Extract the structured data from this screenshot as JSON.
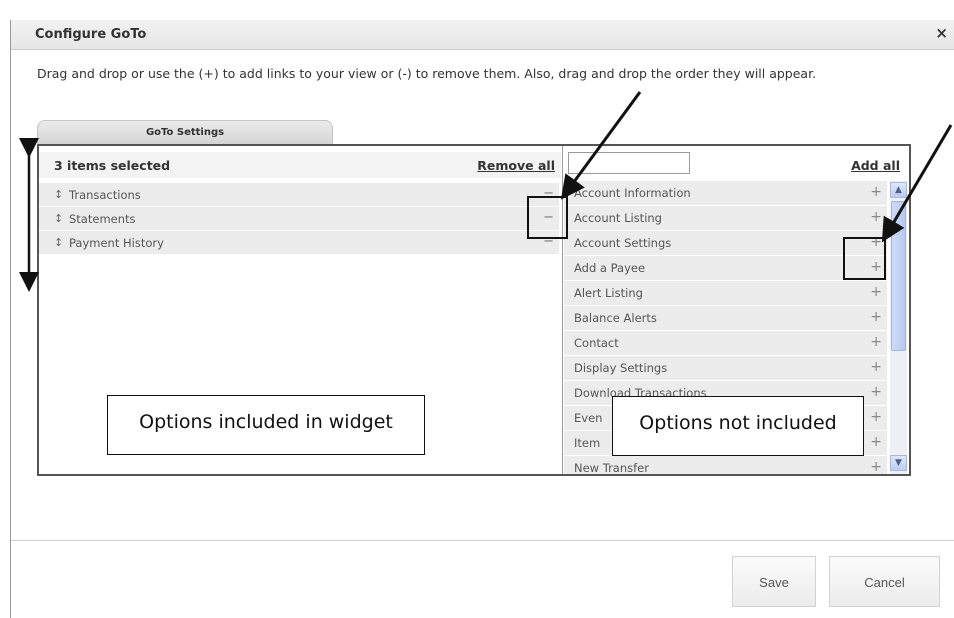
{
  "dialog": {
    "title": "Configure GoTo",
    "close_label": "×",
    "instructions": "Drag and drop or use the (+) to add links to your view or (-) to remove them. Also, drag and drop the order they will appear."
  },
  "tab": {
    "label": "GoTo Settings"
  },
  "selected": {
    "count_label": "3 items selected",
    "remove_all_label": "Remove all",
    "items": [
      {
        "label": "Transactions"
      },
      {
        "label": "Statements"
      },
      {
        "label": "Payment History"
      }
    ]
  },
  "available": {
    "search_value": "",
    "add_all_label": "Add all",
    "items": [
      {
        "label": "Account Information"
      },
      {
        "label": "Account Listing"
      },
      {
        "label": "Account Settings"
      },
      {
        "label": "Add a Payee"
      },
      {
        "label": "Alert Listing"
      },
      {
        "label": "Balance Alerts"
      },
      {
        "label": "Contact"
      },
      {
        "label": "Display Settings"
      },
      {
        "label": "Download Transactions"
      },
      {
        "label": "Even"
      },
      {
        "label": "Item"
      },
      {
        "label": "New Transfer"
      }
    ]
  },
  "glyphs": {
    "drag": "↕",
    "minus": "−",
    "plus": "+",
    "scroll_up": "▲",
    "scroll_down": "▼"
  },
  "annotations": {
    "included": "Options included in widget",
    "not_included": "Options not included"
  },
  "footer": {
    "save_label": "Save",
    "cancel_label": "Cancel"
  }
}
